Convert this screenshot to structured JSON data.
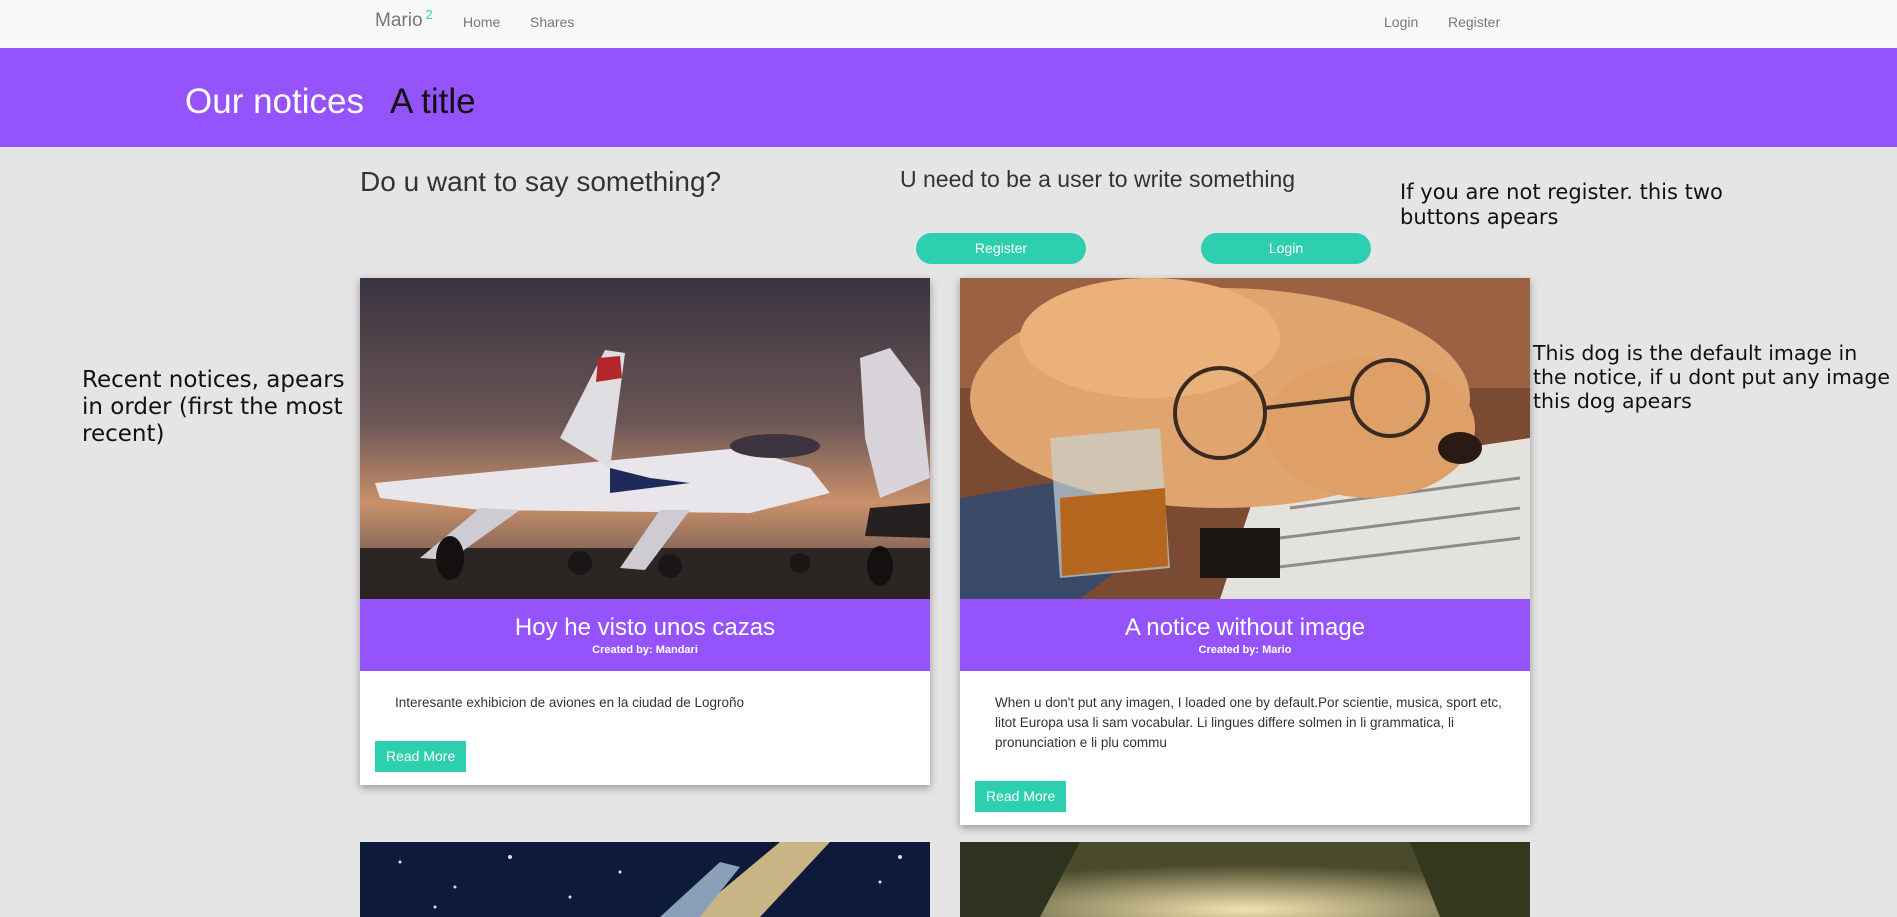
{
  "navbar": {
    "brand": "Mario",
    "badge": "2",
    "links": {
      "home": "Home",
      "shares": "Shares",
      "login": "Login",
      "register": "Register"
    }
  },
  "hero": {
    "title": "Our notices",
    "subtitle": "A title"
  },
  "main": {
    "prompt": "Do u want to say something?",
    "need_user": "U need to be a user to write something",
    "register_button": "Register",
    "login_button": "Login"
  },
  "annotations": {
    "buttons_note": "If you are not register. this two buttons apears",
    "recent_note": "Recent notices, apears in order (first the most recent)",
    "dog_note": "This dog is the default image in the notice, if u dont put any image this dog apears"
  },
  "notices": [
    {
      "title": "Hoy he visto unos cazas",
      "author": "Created by: Mandari",
      "text": "Interesante exhibicion de aviones en la ciudad de Logroño",
      "read_more": "Read More",
      "image": "fighter-jet-sunset"
    },
    {
      "title": "A notice without image",
      "author": "Created by: Mario",
      "text": "When u don't put any imagen, I loaded one by default.Por scientie, musica, sport etc, litot Europa usa li sam vocabular. Li lingues differe solmen in li grammatica, li pronunciation e li plu commu",
      "read_more": "Read More",
      "image": "sleeping-puppy-default"
    }
  ],
  "colors": {
    "accent": "#9553fb",
    "button": "#2ecfae",
    "background": "#e5e5e5"
  }
}
